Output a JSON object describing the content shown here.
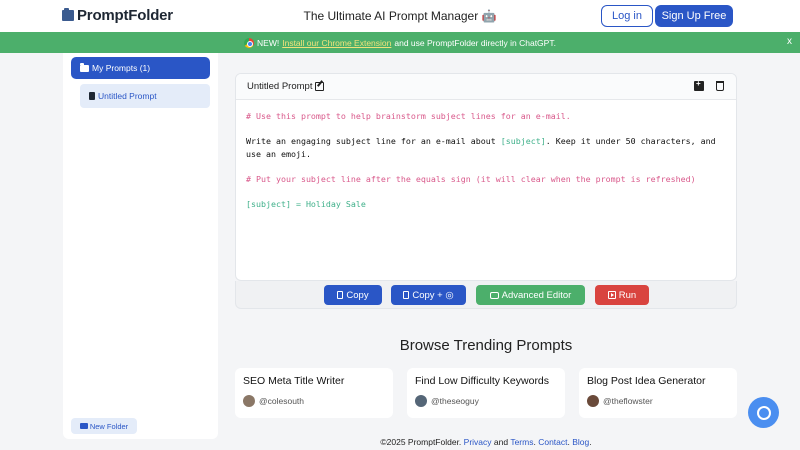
{
  "header": {
    "logo_text": "PromptFolder",
    "tagline": "The Ultimate AI Prompt Manager 🤖",
    "login_label": "Log in",
    "signup_label": "Sign Up Free"
  },
  "banner": {
    "prefix": "NEW!",
    "link_text": "Install our Chrome Extension",
    "suffix": "and use PromptFolder directly in ChatGPT.",
    "close_label": "x"
  },
  "sidebar": {
    "folder_label": "My Prompts (1)",
    "prompt_item_label": "Untitled Prompt",
    "new_folder_label": "New Folder"
  },
  "editor": {
    "title": "Untitled Prompt",
    "lines": {
      "comment1": "# Use this prompt to help brainstorm subject lines for an e-mail.",
      "body_a": "Write an engaging subject line for an e-mail about ",
      "body_var": "[subject]",
      "body_b": ". Keep it under 50 characters, and use an emoji.",
      "comment2": "# Put your subject line after the equals sign (it will clear when the prompt is refreshed)",
      "assignment": "[subject] = Holiday Sale"
    }
  },
  "actions": {
    "copy": "Copy",
    "copy_plus": "Copy + ◎",
    "advanced": "Advanced Editor",
    "run": "Run"
  },
  "trending": {
    "title": "Browse Trending Prompts",
    "cards": [
      {
        "title": "SEO Meta Title Writer",
        "author": "@colesouth"
      },
      {
        "title": "Find Low Difficulty Keywords",
        "author": "@theseoguy"
      },
      {
        "title": "Blog Post Idea Generator",
        "author": "@theflowster"
      }
    ]
  },
  "footer": {
    "copyright": "©2025 PromptFolder.",
    "privacy": "Privacy",
    "and": "and",
    "terms": "Terms",
    "contact": "Contact",
    "blog": "Blog"
  },
  "colors": {
    "primary": "#2a56c6",
    "banner": "#4caf6b",
    "run": "#d9443f",
    "comment": "#d9598b",
    "variable": "#3fb08a"
  }
}
